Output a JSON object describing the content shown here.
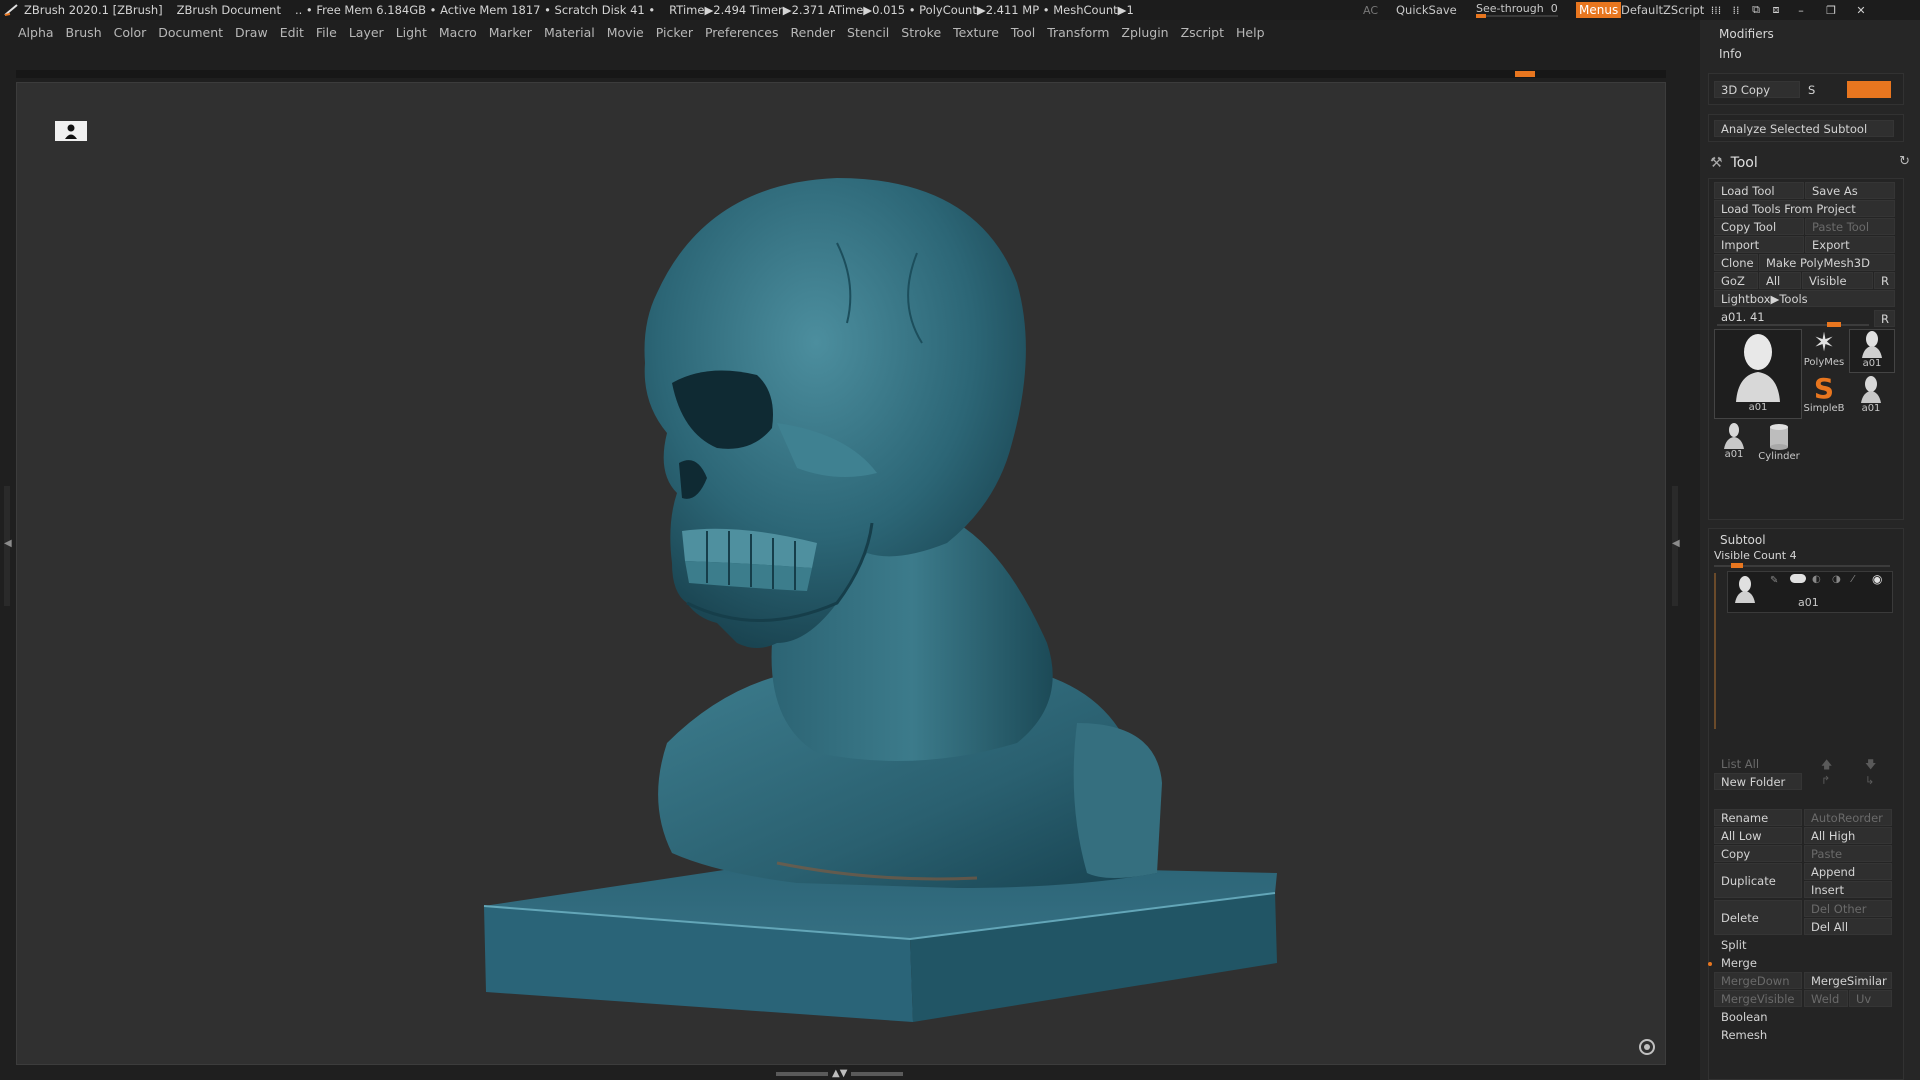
{
  "titlebar": {
    "app": "ZBrush 2020.1 [ZBrush]",
    "document": "ZBrush Document",
    "stats": ".. • Free Mem 6.184GB • Active Mem 1817 • Scratch Disk 41 •",
    "timers": "RTime▶2.494 Timer▶2.371 ATime▶0.015 • PolyCount▶2.411 MP  • MeshCount▶1",
    "ac": "AC",
    "quicksave": "QuickSave",
    "see_through_label": "See-through",
    "see_through_value": "0",
    "menus": "Menus",
    "script": "DefaultZScript"
  },
  "menubar": [
    "Alpha",
    "Brush",
    "Color",
    "Document",
    "Draw",
    "Edit",
    "File",
    "Layer",
    "Light",
    "Macro",
    "Marker",
    "Material",
    "Movie",
    "Picker",
    "Preferences",
    "Render",
    "Stencil",
    "Stroke",
    "Texture",
    "Tool",
    "Transform",
    "Zplugin",
    "Zscript",
    "Help"
  ],
  "panel": {
    "modifiers": "Modifiers",
    "info": "Info",
    "copy3d": "3D Copy",
    "s_label": "S",
    "analyze": "Analyze Selected Subtool",
    "tool_title": "Tool",
    "load_tool": "Load Tool",
    "save_as": "Save As",
    "load_from_project": "Load Tools From Project",
    "copy_tool": "Copy Tool",
    "paste_tool": "Paste Tool",
    "import": "Import",
    "export": "Export",
    "clone": "Clone",
    "make_polymesh": "Make PolyMesh3D",
    "goz": "GoZ",
    "all": "All",
    "visible": "Visible",
    "r": "R",
    "lightbox_tools": "Lightbox▶Tools",
    "current_tool": "a01. 41",
    "thumbs": [
      "a01",
      "PolyMes",
      "a01",
      "SimpleB",
      "a01",
      "a01",
      "Cylinder"
    ],
    "subtool_title": "Subtool",
    "visible_count": "Visible Count 4",
    "subtool_item": "a01",
    "list_all": "List All",
    "new_folder": "New Folder",
    "rename": "Rename",
    "auto_reorder": "AutoReorder",
    "all_low": "All Low",
    "all_high": "All High",
    "copy": "Copy",
    "paste": "Paste",
    "duplicate": "Duplicate",
    "append": "Append",
    "insert": "Insert",
    "delete": "Delete",
    "del_other": "Del Other",
    "del_all": "Del All",
    "split": "Split",
    "merge": "Merge",
    "merge_down": "MergeDown",
    "merge_similar": "MergeSimilar",
    "merge_visible": "MergeVisible",
    "weld": "Weld",
    "uv": "Uv",
    "boolean": "Boolean",
    "remesh": "Remesh"
  },
  "colors": {
    "accent": "#e8761f",
    "model": "#2f6f80",
    "canvas": "#303030"
  }
}
